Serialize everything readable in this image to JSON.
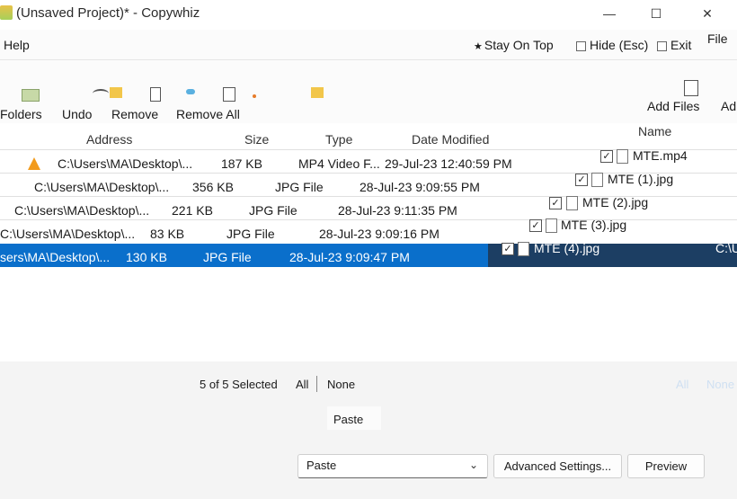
{
  "window": {
    "title": "(Unsaved Project)* - Copywhiz",
    "minimize_glyph": "—",
    "maximize_glyph": "☐",
    "close_glyph": "✕"
  },
  "menu": {
    "help": "Help",
    "stay_on_top": "Stay On Top",
    "hide": "Hide (Esc)",
    "exit": "Exit",
    "file": "File"
  },
  "toolbar": {
    "folders": "Folders",
    "undo": "Undo",
    "remove": "Remove",
    "remove_all": "Remove All",
    "add_files": "Add Files",
    "add_partial": "Ad"
  },
  "columns": {
    "name": "Name",
    "address": "Address",
    "size": "Size",
    "type": "Type",
    "date_modified": "Date Modified"
  },
  "rows": [
    {
      "name": "MTE.mp4",
      "address": "C:\\Users\\MA\\Desktop\\...",
      "size": "187 KB",
      "type": "MP4 Video F...",
      "date": "29-Jul-23 12:40:59 PM"
    },
    {
      "name": "MTE (1).jpg",
      "address": "C:\\Users\\MA\\Desktop\\...",
      "size": "356 KB",
      "type": "JPG File",
      "date": "28-Jul-23 9:09:55 PM"
    },
    {
      "name": "MTE (2).jpg",
      "address": "C:\\Users\\MA\\Desktop\\...",
      "size": "221 KB",
      "type": "JPG File",
      "date": "28-Jul-23 9:11:35 PM"
    },
    {
      "name": "MTE (3).jpg",
      "address": "C:\\Users\\MA\\Desktop\\...",
      "size": "83 KB",
      "type": "JPG File",
      "date": "28-Jul-23 9:09:16 PM"
    },
    {
      "name": "MTE (4).jpg",
      "address": "sers\\MA\\Desktop\\...",
      "size": "130 KB",
      "type": "JPG File",
      "date": "28-Jul-23 9:09:47 PM",
      "address_right": "C:\\U"
    }
  ],
  "selection": {
    "count": "5 of 5 Selected",
    "all": "All",
    "none": "None",
    "check": "✓"
  },
  "bottom": {
    "paste_label": "Paste",
    "paste_option": "Paste",
    "advanced_settings": "Advanced Settings...",
    "preview": "Preview",
    "chevron": "⌄"
  },
  "colors": {
    "selection_blue": "#0a6fcb",
    "selection_dark": "#1c3e63",
    "vlc_orange": "#f29b1d"
  }
}
